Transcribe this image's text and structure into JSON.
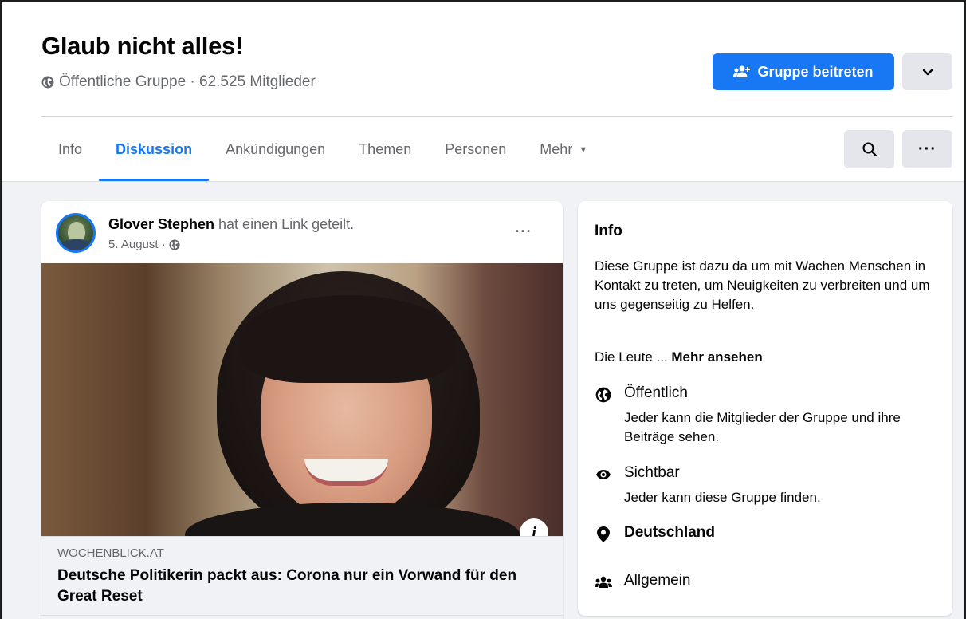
{
  "group": {
    "title": "Glaub nicht alles!",
    "meta": "Öffentliche Gruppe · 62.525 Mitglieder",
    "join_label": "Gruppe beitreten"
  },
  "tabs": [
    {
      "label": "Info",
      "active": false
    },
    {
      "label": "Diskussion",
      "active": true
    },
    {
      "label": "Ankündigungen",
      "active": false
    },
    {
      "label": "Themen",
      "active": false
    },
    {
      "label": "Personen",
      "active": false
    },
    {
      "label": "Mehr",
      "active": false
    }
  ],
  "toolbar": {
    "more_label": "···"
  },
  "post": {
    "author": "Glover Stephen",
    "action": " hat einen Link geteilt.",
    "date": "5. August ·",
    "more_label": "···",
    "image_info_label": "i",
    "link_domain": "WOCHENBLICK.AT",
    "link_title": "Deutsche Politikerin packt aus: Corona nur ein Vorwand für den Great Reset"
  },
  "info": {
    "heading": "Info",
    "description": "Diese Gruppe ist dazu da um mit Wachen Menschen in Kontakt zu treten, um Neuigkeiten zu verbreiten und um uns gegenseitig zu Helfen.",
    "more_prefix": "Die Leute ... ",
    "more_link": "Mehr ansehen",
    "items": [
      {
        "icon": "globe-icon",
        "title": "Öffentlich",
        "sub": "Jeder kann die Mitglieder der Gruppe und ihre Beiträge sehen."
      },
      {
        "icon": "eye-icon",
        "title": "Sichtbar",
        "sub": "Jeder kann diese Gruppe finden."
      },
      {
        "icon": "location-pin-icon",
        "title": "Deutschland",
        "sub": ""
      },
      {
        "icon": "group-icon",
        "title": "Allgemein",
        "sub": ""
      }
    ]
  },
  "colors": {
    "accent": "#1877f2",
    "background": "#f0f2f5",
    "text": "#050505",
    "secondary_text": "#65676b",
    "button_gray": "#e4e6eb"
  }
}
